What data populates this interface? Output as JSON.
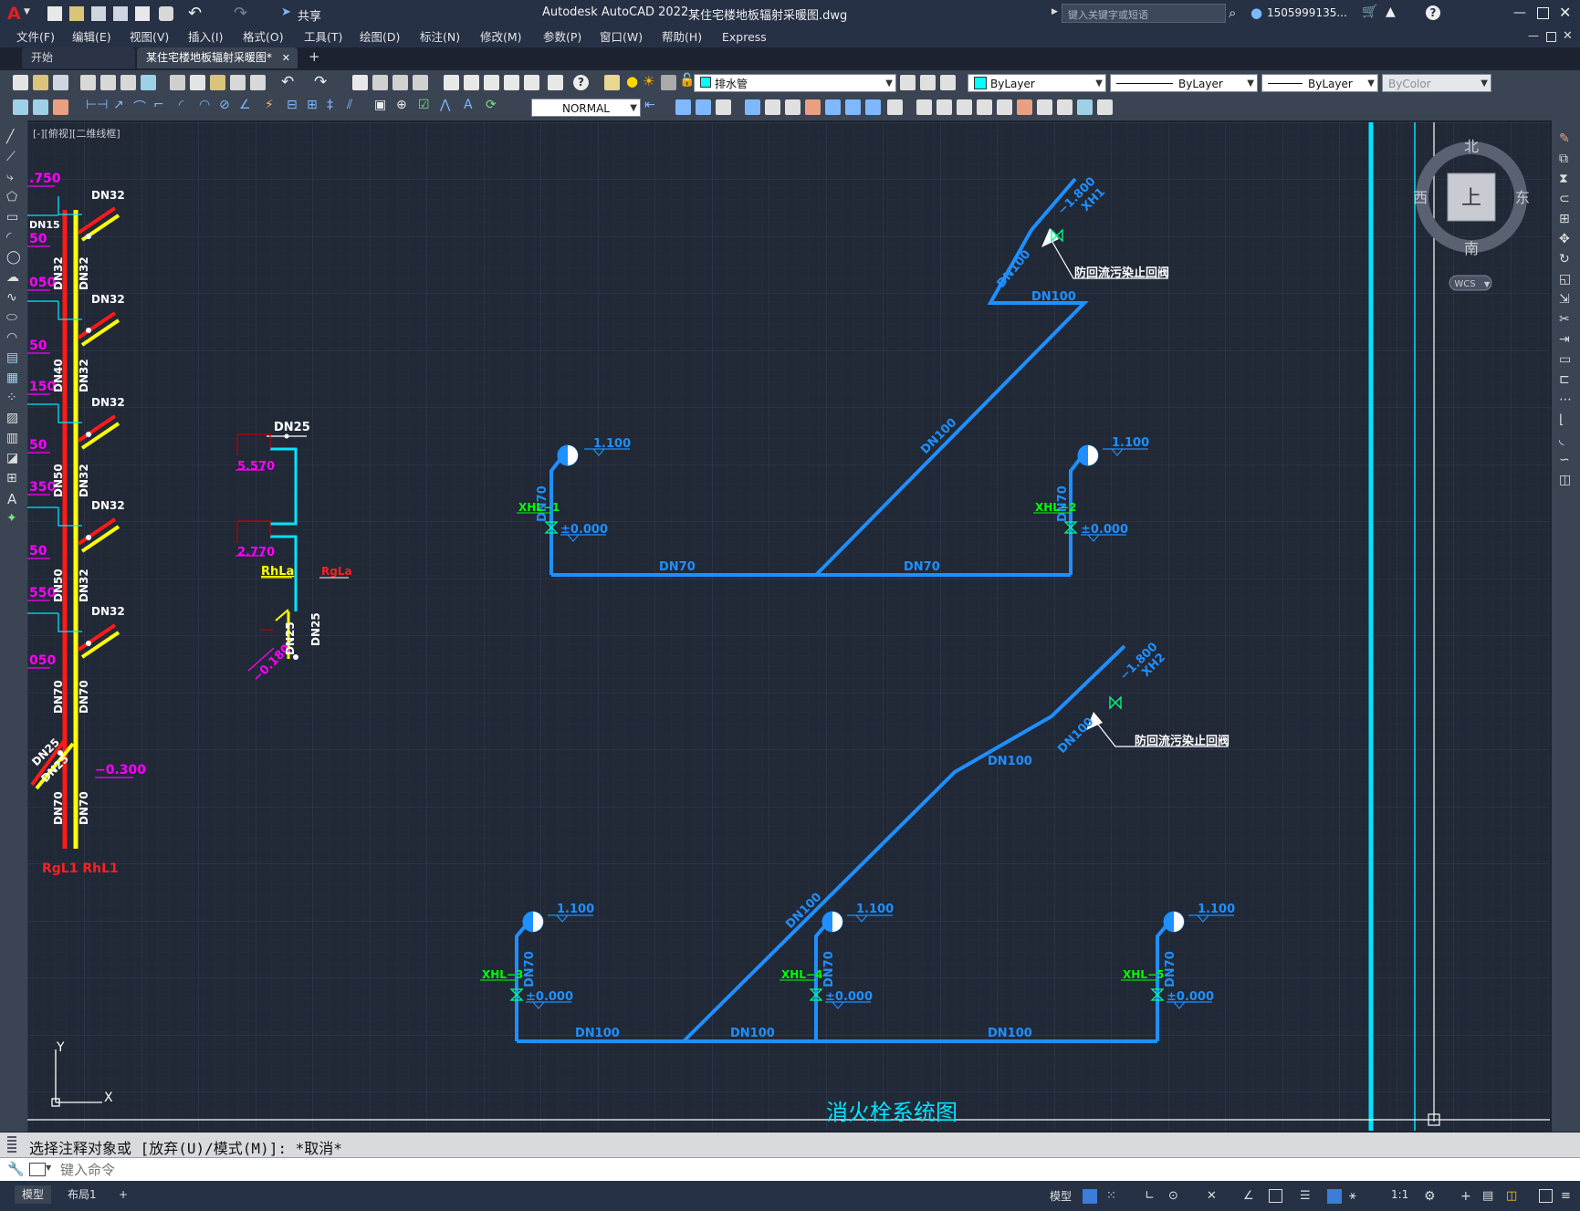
{
  "title_bar": {
    "app_title": "Autodesk AutoCAD 2022",
    "file_name": "某住宅楼地板辐射采暖图.dwg",
    "share_label": "共享",
    "search_placeholder": "键入关键字或短语",
    "user_name": "1505999135...",
    "help_label": "?"
  },
  "menu": [
    "文件(F)",
    "编辑(E)",
    "视图(V)",
    "插入(I)",
    "格式(O)",
    "工具(T)",
    "绘图(D)",
    "标注(N)",
    "修改(M)",
    "参数(P)",
    "窗口(W)",
    "帮助(H)",
    "Express"
  ],
  "tabs": {
    "start": "开始",
    "active": "某住宅楼地板辐射采暖图*",
    "add": "+"
  },
  "toolbar": {
    "layer_name": "排水管",
    "color": "ByLayer",
    "linetype": "ByLayer",
    "lineweight": "ByLayer",
    "plotstyle": "ByColor",
    "dimstyle": "NORMAL",
    "layer_color": "#00ffff"
  },
  "viewport": {
    "label": "[-][俯视][二维线框]"
  },
  "viewcube": {
    "north": "北",
    "south": "南",
    "east": "东",
    "west": "西",
    "face": "上",
    "wcs": "WCS"
  },
  "ucs": {
    "x": "X",
    "y": "Y"
  },
  "drawing": {
    "title": "消火栓系统图",
    "left_column": {
      "elevations": [
        ".750",
        "50",
        "050",
        "50",
        "150",
        "50",
        "350",
        "50",
        "550",
        "050",
        "−0.300"
      ],
      "pipe_labels": [
        "DN32",
        "DN32",
        "DN32",
        "DN32",
        "DN32",
        "DN32",
        "DN32",
        "DN32",
        "DN32",
        "DN32",
        "DN40",
        "DN50",
        "DN50",
        "DN70",
        "DN70",
        "DN70",
        "DN70",
        "DN25",
        "DN25",
        "DN15"
      ],
      "riser_names": "RgL1 RhL1"
    },
    "small_riser": {
      "top_label": "DN25",
      "elevations": [
        "5.570",
        "2.770",
        "−0.180"
      ],
      "names": [
        "RhLa",
        "RgLa"
      ],
      "pipe_labels": [
        "DN25",
        "DN25"
      ]
    },
    "system1": {
      "inlet_elev": "−1.800",
      "inlet_name": "XH1",
      "valve_note": "防回流污染止回阀",
      "pipes": [
        "DN100",
        "DN100",
        "DN100",
        "DN70",
        "DN70",
        "DN70",
        "DN70"
      ],
      "hydrants": [
        {
          "name": "XHL−1",
          "top": "1.100",
          "base": "±0.000"
        },
        {
          "name": "XHL−2",
          "top": "1.100",
          "base": "±0.000"
        }
      ]
    },
    "system2": {
      "inlet_elev": "−1.800",
      "inlet_name": "XH2",
      "valve_note": "防回流污染止回阀",
      "pipes": [
        "DN100",
        "DN100",
        "DN100",
        "DN100",
        "DN100",
        "DN100",
        "DN70",
        "DN70",
        "DN70"
      ],
      "hydrants": [
        {
          "name": "XHL−3",
          "top": "1.100",
          "base": "±0.000"
        },
        {
          "name": "XHL−4",
          "top": "1.100",
          "base": "±0.000"
        },
        {
          "name": "XHL−5",
          "top": "1.100",
          "base": "±0.000"
        }
      ]
    }
  },
  "command": {
    "history": "选择注释对象或 [放弃(U)/模式(M)]: *取消*",
    "placeholder": "键入命令"
  },
  "status_bar": {
    "model_tab": "模型",
    "layout_tab": "布局1",
    "add": "+",
    "model_button": "模型",
    "scale": "1:1"
  }
}
